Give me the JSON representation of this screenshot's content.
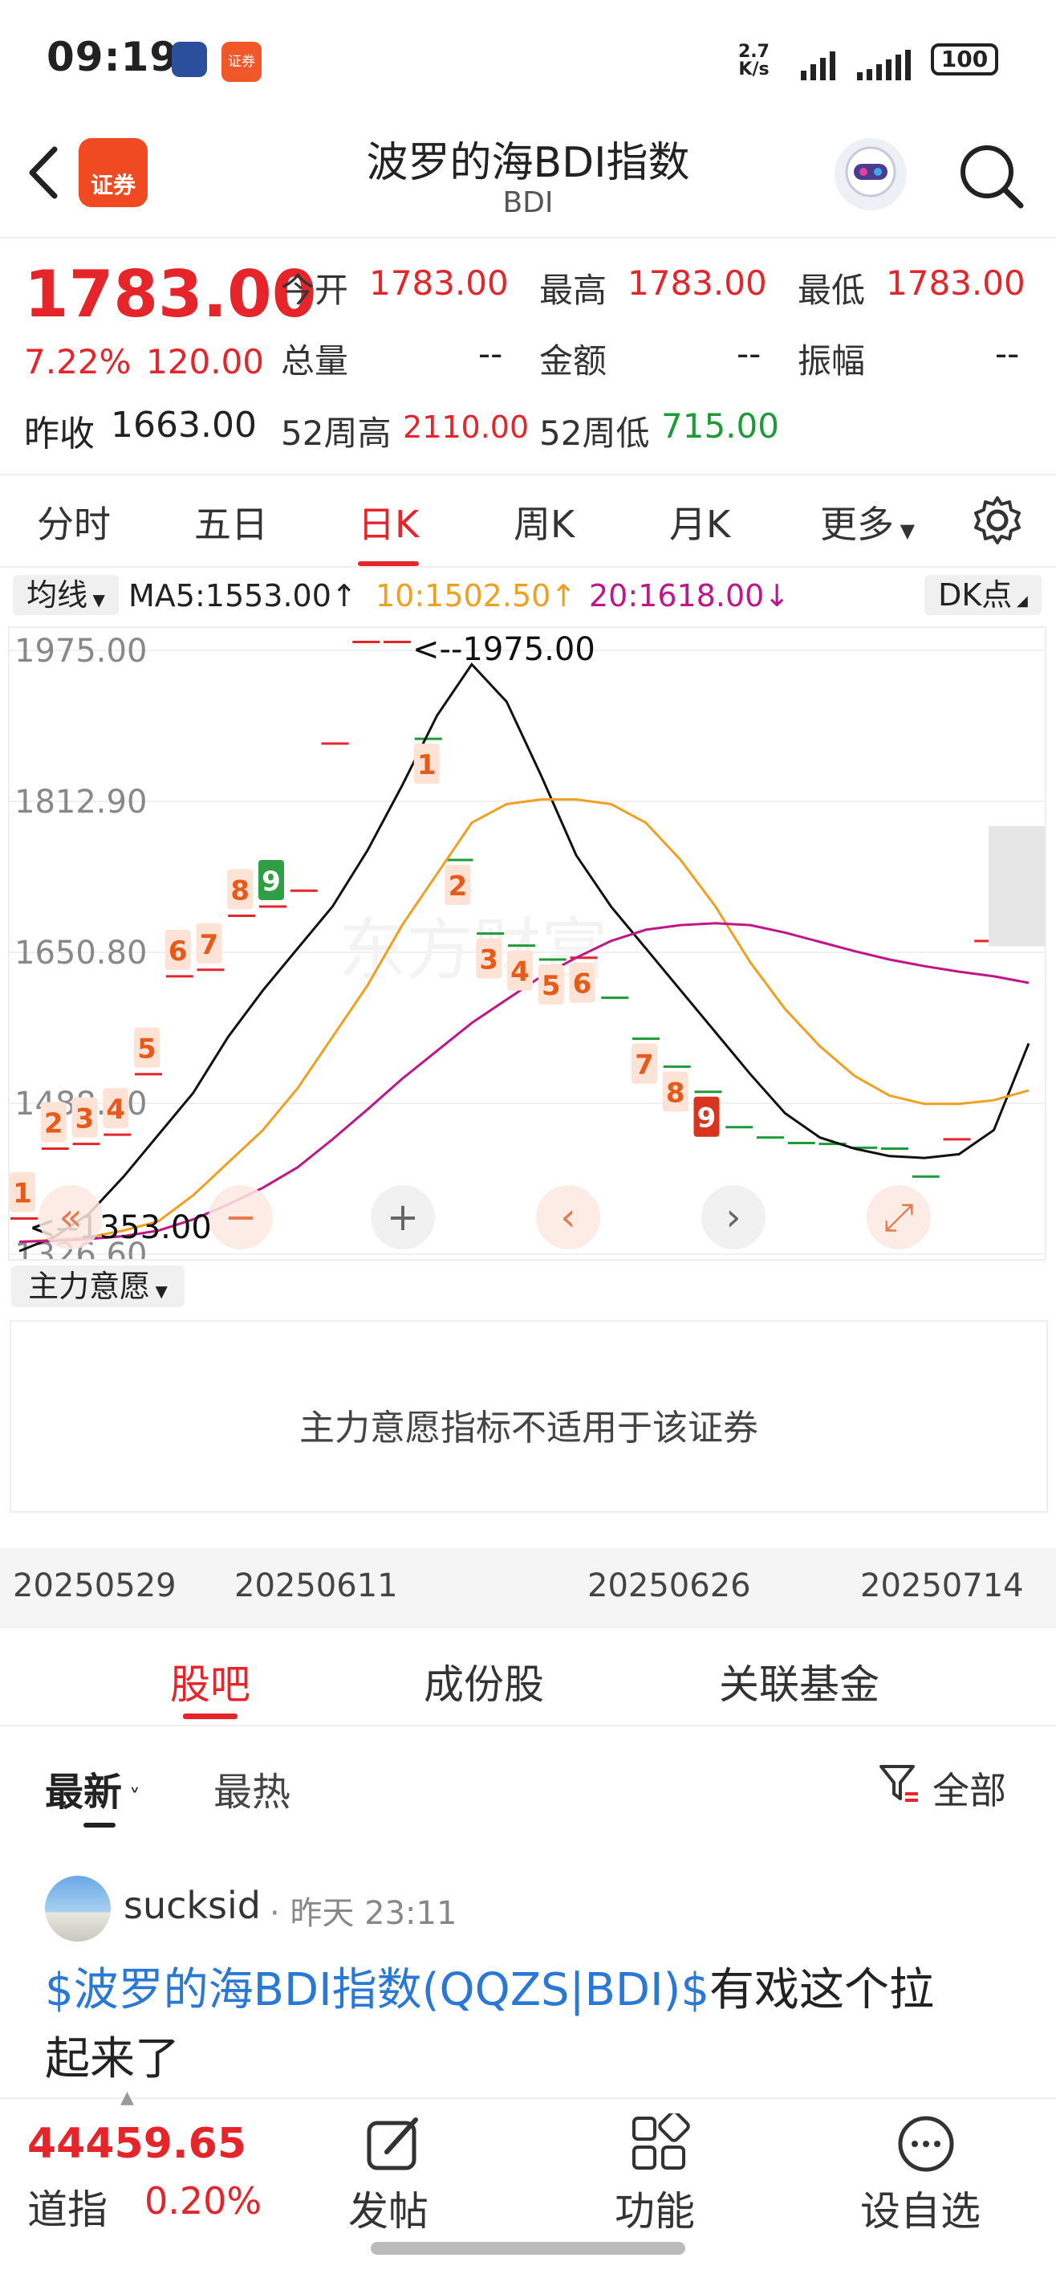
{
  "status_bar": {
    "time": "09:19",
    "app_badge": "证券",
    "net_speed_top": "2.7",
    "net_speed_unit": "K/s",
    "battery": "100"
  },
  "header": {
    "title": "波罗的海BDI指数",
    "subtitle": "BDI",
    "logo_text": "证券"
  },
  "quote": {
    "price": "1783.00",
    "change_pct": "7.22%",
    "change": "120.00",
    "open_label": "今开",
    "open": "1783.00",
    "high_label": "最高",
    "high": "1783.00",
    "low_label": "最低",
    "low": "1783.00",
    "volume_label": "总量",
    "volume": "--",
    "amount_label": "金额",
    "amount": "--",
    "amplitude_label": "振幅",
    "amplitude": "--",
    "prev_close_label": "昨收",
    "prev_close": "1663.00",
    "wk52_high_label": "52周高",
    "wk52_high": "2110.00",
    "wk52_low_label": "52周低",
    "wk52_low": "715.00"
  },
  "kline_tabs": {
    "items": [
      "分时",
      "五日",
      "日K",
      "周K",
      "月K",
      "更多"
    ],
    "active": "日K"
  },
  "ma_legend": {
    "selector": "均线",
    "ma5": "MA5:1553.00",
    "ma10": "10:1502.50",
    "ma20": "20:1618.00",
    "dk": "DK点",
    "colors": {
      "ma5": "#111111",
      "ma10": "#f0a020",
      "ma20": "#c0168a",
      "up": "#e6252b",
      "down": "#1e9b38"
    }
  },
  "chart_data": {
    "type": "line",
    "y_ticks": [
      "1975.00",
      "1812.90",
      "1650.80",
      "1488.70",
      "1326.60"
    ],
    "ylim": [
      1326.6,
      1975
    ],
    "max_label": "<--1975.00",
    "min_label": "<--1353.00",
    "x_tick_labels": [
      "20250529",
      "20250611",
      "20250626",
      "20250714"
    ],
    "candles": [
      1365,
      1440,
      1445,
      1455,
      1520,
      1625,
      1632,
      1690,
      1700,
      1717,
      1875,
      1984,
      1984,
      1880,
      1750,
      1671,
      1658,
      1643,
      1645,
      1602,
      1558,
      1528,
      1501,
      1463,
      1452,
      1446,
      1445,
      1441,
      1440,
      1410,
      1450,
      1663,
      1783
    ],
    "nine_labels": [
      {
        "idx": 0,
        "text": "1"
      },
      {
        "idx": 1,
        "text": "2"
      },
      {
        "idx": 2,
        "text": "3"
      },
      {
        "idx": 3,
        "text": "4"
      },
      {
        "idx": 4,
        "text": "5"
      },
      {
        "idx": 5,
        "text": "6"
      },
      {
        "idx": 6,
        "text": "7"
      },
      {
        "idx": 7,
        "text": "8"
      },
      {
        "idx": 8,
        "text": "9"
      },
      {
        "idx": 13,
        "text": "1"
      },
      {
        "idx": 14,
        "text": "2"
      },
      {
        "idx": 15,
        "text": "3"
      },
      {
        "idx": 16,
        "text": "4"
      },
      {
        "idx": 17,
        "text": "5"
      },
      {
        "idx": 18,
        "text": "6"
      },
      {
        "idx": 20,
        "text": "7"
      },
      {
        "idx": 21,
        "text": "8"
      },
      {
        "idx": 22,
        "text": "9"
      }
    ],
    "series": [
      {
        "name": "MA5",
        "values": [
          1330,
          1345,
          1370,
          1410,
          1455,
          1500,
          1560,
          1610,
          1655,
          1700,
          1760,
          1830,
          1905,
          1960,
          1920,
          1840,
          1755,
          1700,
          1655,
          1610,
          1565,
          1520,
          1478,
          1452,
          1440,
          1432,
          1430,
          1434,
          1460,
          1553
        ]
      },
      {
        "name": "10",
        "values": [
          1340,
          1342,
          1345,
          1352,
          1362,
          1390,
          1425,
          1460,
          1505,
          1560,
          1615,
          1680,
          1735,
          1790,
          1810,
          1815,
          1815,
          1810,
          1790,
          1750,
          1700,
          1640,
          1590,
          1550,
          1518,
          1497,
          1488,
          1488,
          1492,
          1502.5
        ]
      },
      {
        "name": "20",
        "values": [
          1340,
          1341,
          1343,
          1346,
          1352,
          1364,
          1380,
          1398,
          1420,
          1450,
          1482,
          1515,
          1545,
          1575,
          1600,
          1625,
          1645,
          1663,
          1675,
          1680,
          1682,
          1680,
          1672,
          1662,
          1652,
          1643,
          1636,
          1630,
          1625,
          1618
        ]
      }
    ]
  },
  "indicator": {
    "selector": "主力意愿",
    "message": "主力意愿指标不适用于该证券"
  },
  "community_tabs": {
    "items": [
      "股吧",
      "成份股",
      "关联基金"
    ],
    "active": "股吧"
  },
  "filters": {
    "latest": "最新",
    "hot": "最热",
    "all": "全部"
  },
  "post": {
    "username": "sucksid",
    "time": "昨天 23:11",
    "tag": "$波罗的海BDI指数(QQZS|BDI)$",
    "text_line1": "有戏这个拉",
    "text_line2": "起来了"
  },
  "bottom_bar": {
    "index_value": "44459.65",
    "index_name": "道指",
    "index_change": "0.20%",
    "post_label": "发帖",
    "func_label": "功能",
    "watch_label": "设自选"
  },
  "watermark": "东方财富"
}
